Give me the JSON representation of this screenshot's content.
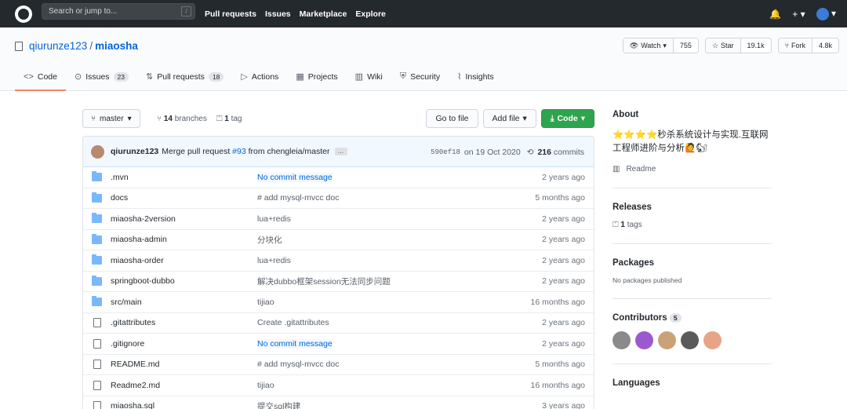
{
  "header": {
    "search_placeholder": "Search or jump to...",
    "search_key": "/",
    "nav": [
      "Pull requests",
      "Issues",
      "Marketplace",
      "Explore"
    ]
  },
  "repo": {
    "owner": "qiurunze123",
    "separator": "/",
    "name": "miaosha",
    "watch": {
      "label": "Watch",
      "count": "755"
    },
    "star": {
      "label": "Star",
      "count": "19.1k"
    },
    "fork": {
      "label": "Fork",
      "count": "4.8k"
    },
    "tabs": [
      {
        "label": "Code",
        "icon": "<>"
      },
      {
        "label": "Issues",
        "count": "23"
      },
      {
        "label": "Pull requests",
        "count": "18"
      },
      {
        "label": "Actions"
      },
      {
        "label": "Projects"
      },
      {
        "label": "Wiki"
      },
      {
        "label": "Security"
      },
      {
        "label": "Insights"
      }
    ]
  },
  "toolbar": {
    "branch": "master",
    "branches_count": "14",
    "branches_label": "branches",
    "tags_count": "1",
    "tags_label": "tag",
    "go_to_file": "Go to file",
    "add_file": "Add file",
    "code": "Code"
  },
  "commit": {
    "author": "qiurunze123",
    "message_pre": "Merge pull request",
    "pr": "#93",
    "message_post": "from chengleia/master",
    "dots": "…",
    "sha": "590ef18",
    "date": "on 19 Oct 2020",
    "commits_count": "216",
    "commits_label": "commits"
  },
  "files": [
    {
      "name": ".mvn",
      "type": "dir",
      "message": "No commit message",
      "link": true,
      "age": "2 years ago"
    },
    {
      "name": "docs",
      "type": "dir",
      "message": "# add mysql-mvcc doc",
      "link": false,
      "age": "5 months ago"
    },
    {
      "name": "miaosha-2version",
      "type": "dir",
      "message": "lua+redis",
      "link": false,
      "age": "2 years ago"
    },
    {
      "name": "miaosha-admin",
      "type": "dir",
      "message": "分块化",
      "link": false,
      "age": "2 years ago"
    },
    {
      "name": "miaosha-order",
      "type": "dir",
      "message": "lua+redis",
      "link": false,
      "age": "2 years ago"
    },
    {
      "name": "springboot-dubbo",
      "type": "dir",
      "message": "解决dubbo框架session无法同步问题",
      "link": false,
      "age": "2 years ago"
    },
    {
      "name": "src/main",
      "type": "dir",
      "message": "tijiao",
      "link": false,
      "age": "16 months ago"
    },
    {
      "name": ".gitattributes",
      "type": "file",
      "message": "Create .gitattributes",
      "link": false,
      "age": "2 years ago"
    },
    {
      "name": ".gitignore",
      "type": "file",
      "message": "No commit message",
      "link": true,
      "age": "2 years ago"
    },
    {
      "name": "README.md",
      "type": "file",
      "message": "# add mysql-mvcc doc",
      "link": false,
      "age": "5 months ago"
    },
    {
      "name": "Readme2.md",
      "type": "file",
      "message": "tijiao",
      "link": false,
      "age": "16 months ago"
    },
    {
      "name": "miaosha.sql",
      "type": "file",
      "message": "提交sql构建",
      "link": false,
      "age": "3 years ago"
    }
  ],
  "sidebar": {
    "about_title": "About",
    "description": "⭐⭐⭐⭐秒杀系统设计与实现.互联网工程师进阶与分析🙋🐿",
    "readme": "Readme",
    "releases_title": "Releases",
    "tags_count": "1",
    "tags_label": "tags",
    "packages_title": "Packages",
    "packages_text": "No packages published",
    "contributors_title": "Contributors",
    "contributors_count": "5",
    "contributor_colors": [
      "#8a8a8a",
      "#9b59d0",
      "#c9a27a",
      "#5a5a5a",
      "#e8a487"
    ],
    "languages_title": "Languages"
  }
}
